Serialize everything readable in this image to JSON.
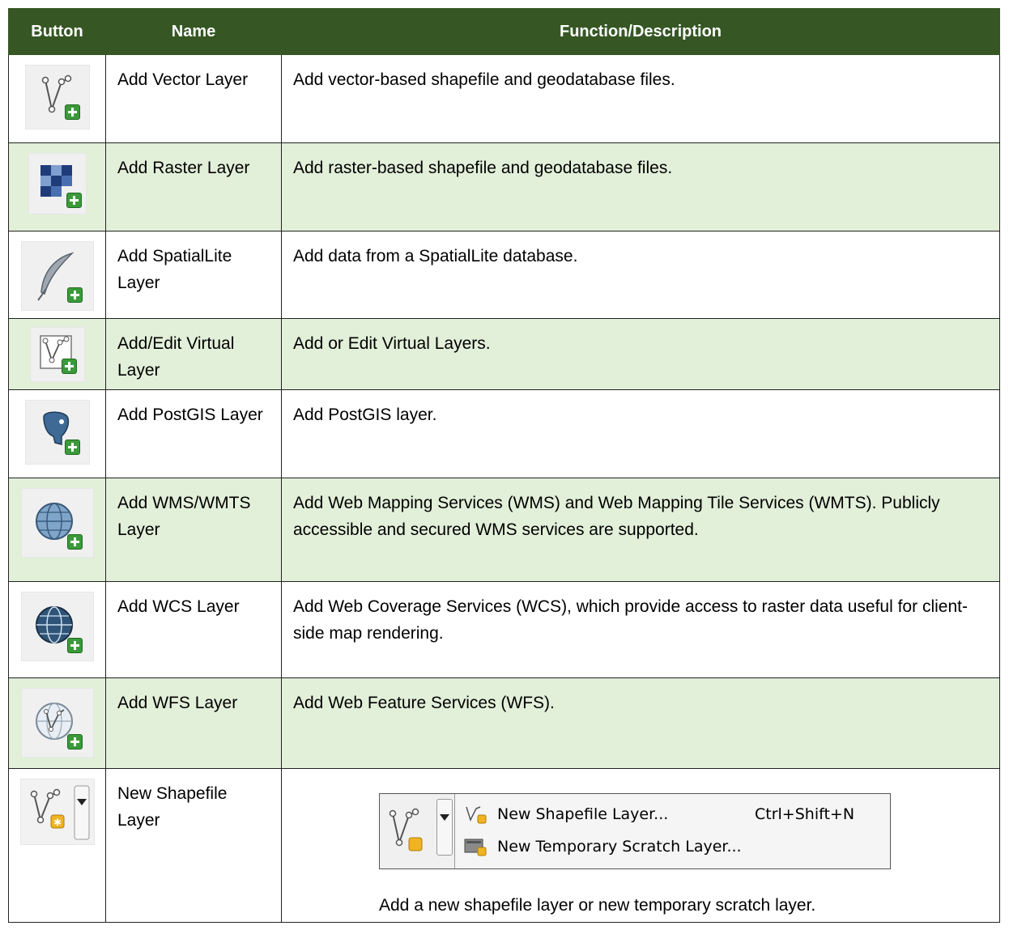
{
  "headers": [
    "Button",
    "Name",
    "Function/Description"
  ],
  "rows": [
    {
      "icon": "add-vector-layer-icon",
      "name": "Add Vector Layer",
      "desc": "Add vector-based shapefile and geodatabase files."
    },
    {
      "icon": "add-raster-layer-icon",
      "name": "Add Raster Layer",
      "desc": "Add raster-based shapefile and geodatabase files."
    },
    {
      "icon": "add-spatialite-layer-icon",
      "name": "Add SpatialLite Layer",
      "desc": "Add data from a SpatialLite database."
    },
    {
      "icon": "add-virtual-layer-icon",
      "name": "Add/Edit Virtual Layer",
      "desc": "Add or Edit Virtual Layers."
    },
    {
      "icon": "add-postgis-layer-icon",
      "name": "Add PostGIS Layer",
      "desc": "Add PostGIS layer."
    },
    {
      "icon": "add-wms-layer-icon",
      "name": "Add WMS/WMTS Layer",
      "desc": "Add Web Mapping Services (WMS) and Web Mapping Tile Services (WMTS). Publicly accessible and secured WMS services are supported."
    },
    {
      "icon": "add-wcs-layer-icon",
      "name": "Add WCS Layer",
      "desc": "Add Web Coverage Services (WCS), which provide access to raster data useful for client-side map rendering."
    },
    {
      "icon": "add-wfs-layer-icon",
      "name": "Add WFS Layer",
      "desc": "Add Web Feature Services (WFS)."
    },
    {
      "icon": "new-shapefile-layer-icon",
      "name": "New Shapefile Layer",
      "desc": "Add a new shapefile layer or new temporary scratch layer."
    }
  ],
  "menu": {
    "items": [
      {
        "label": "New Shapefile Layer...",
        "shortcut": "Ctrl+Shift+N"
      },
      {
        "label": "New Temporary Scratch Layer...",
        "shortcut": ""
      }
    ]
  },
  "colors": {
    "header_bg": "#365724",
    "alt_row_bg": "#e2efd9",
    "plus_green": "#3a9a3a"
  }
}
